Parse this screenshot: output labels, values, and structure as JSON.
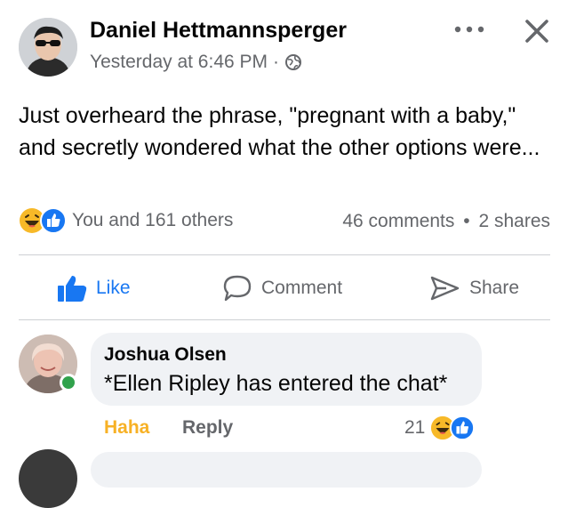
{
  "post": {
    "author": "Daniel Hettmannsperger",
    "timestamp": "Yesterday at 6:46 PM",
    "separator": "·",
    "privacy_icon": "globe-icon",
    "text": "Just overheard the phrase, \"pregnant with a baby,\" and secretly wondered what the other options were...",
    "reactions_text": "You and 161 others",
    "comments_count": "46 comments",
    "stats_separator": "•",
    "shares_count": "2 shares"
  },
  "actions": {
    "like": "Like",
    "comment": "Comment",
    "share": "Share"
  },
  "comment": {
    "author": "Joshua Olsen",
    "text": "*Ellen Ripley has entered the chat*",
    "reaction_label": "Haha",
    "reply_label": "Reply",
    "reaction_count": "21"
  },
  "colors": {
    "like_blue": "#1877f2",
    "haha_yellow": "#f7b125",
    "secondary_text": "#65676b",
    "bubble_bg": "#f0f2f5",
    "online_green": "#31a24c"
  }
}
